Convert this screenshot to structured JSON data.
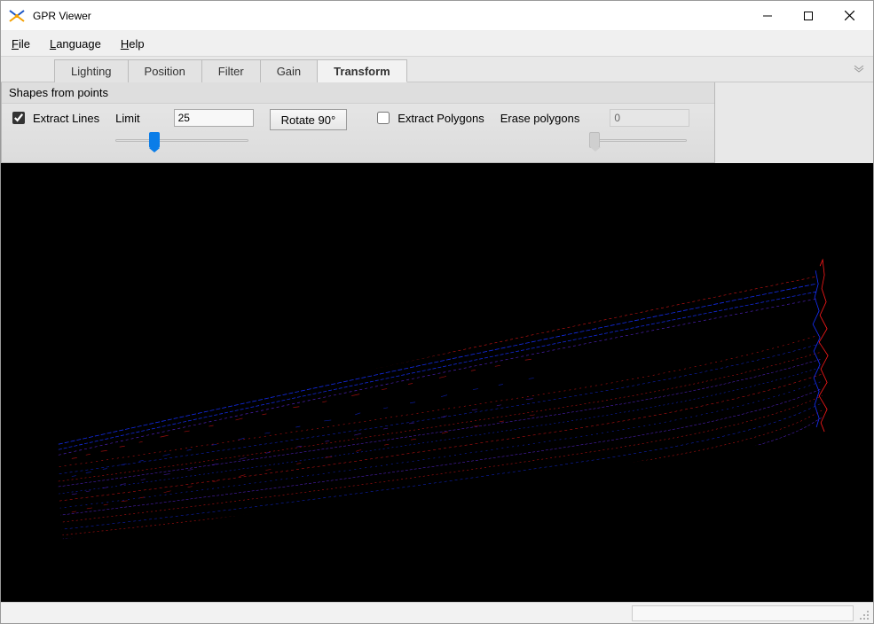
{
  "window": {
    "title": "GPR Viewer"
  },
  "menu": {
    "file": "File",
    "language": "Language",
    "help": "Help"
  },
  "tabs": {
    "lighting": "Lighting",
    "position": "Position",
    "filter": "Filter",
    "gain": "Gain",
    "transform": "Transform",
    "active": "transform"
  },
  "panel": {
    "header": "Shapes from points",
    "extract_lines": {
      "label": "Extract Lines",
      "checked": true
    },
    "limit": {
      "label": "Limit",
      "value": "25",
      "slider_pct": 25
    },
    "rotate_label": "Rotate 90°",
    "extract_polygons": {
      "label": "Extract Polygons",
      "checked": false
    },
    "erase_polygons": {
      "label": "Erase polygons",
      "value": "0",
      "slider_pct": 0
    }
  },
  "colors": {
    "accent": "#0a7de8",
    "data_red": "#ff1a1a",
    "data_blue": "#1530ff",
    "data_purple": "#6a2dff",
    "viewport_bg": "#000000"
  }
}
